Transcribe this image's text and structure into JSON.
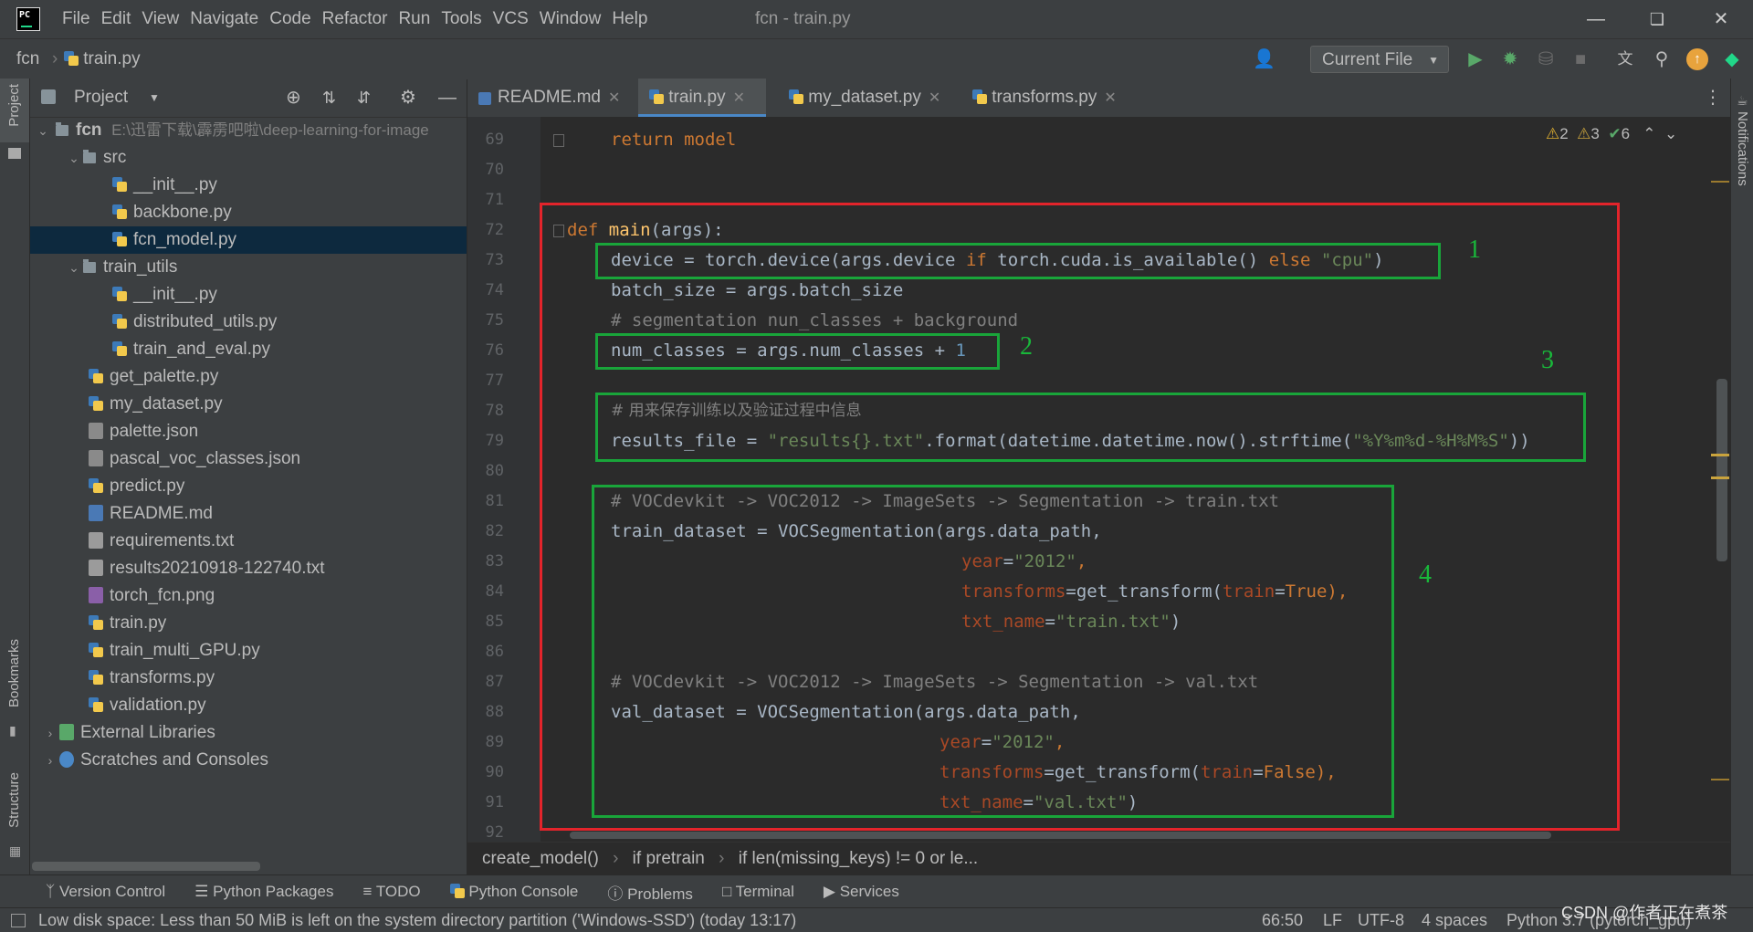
{
  "app": {
    "window_title": "fcn - train.py",
    "menu": [
      "File",
      "Edit",
      "View",
      "Navigate",
      "Code",
      "Refactor",
      "Run",
      "Tools",
      "VCS",
      "Window",
      "Help"
    ]
  },
  "navbar": {
    "project": "fcn",
    "file": "train.py",
    "run_config": "Current File"
  },
  "left_stripe": {
    "project": "Project",
    "bookmarks": "Bookmarks",
    "structure": "Structure"
  },
  "right_stripe": {
    "notifications": "Notifications"
  },
  "project_panel": {
    "title": "Project",
    "root_name": "fcn",
    "root_path": "E:\\迅雷下载\\霹雳吧啦\\deep-learning-for-image",
    "items": [
      {
        "name": "src",
        "type": "folder",
        "depth": 1,
        "expanded": true
      },
      {
        "name": "__init__.py",
        "type": "py",
        "depth": 2
      },
      {
        "name": "backbone.py",
        "type": "py",
        "depth": 2
      },
      {
        "name": "fcn_model.py",
        "type": "py",
        "depth": 2,
        "selected": true
      },
      {
        "name": "train_utils",
        "type": "folder",
        "depth": 1,
        "expanded": true
      },
      {
        "name": "__init__.py",
        "type": "py",
        "depth": 2
      },
      {
        "name": "distributed_utils.py",
        "type": "py",
        "depth": 2
      },
      {
        "name": "train_and_eval.py",
        "type": "py",
        "depth": 2
      },
      {
        "name": "get_palette.py",
        "type": "py",
        "depth": 1
      },
      {
        "name": "my_dataset.py",
        "type": "py",
        "depth": 1
      },
      {
        "name": "palette.json",
        "type": "json",
        "depth": 1
      },
      {
        "name": "pascal_voc_classes.json",
        "type": "json",
        "depth": 1
      },
      {
        "name": "predict.py",
        "type": "py",
        "depth": 1
      },
      {
        "name": "README.md",
        "type": "md",
        "depth": 1
      },
      {
        "name": "requirements.txt",
        "type": "txt",
        "depth": 1
      },
      {
        "name": "results20210918-122740.txt",
        "type": "txt",
        "depth": 1
      },
      {
        "name": "torch_fcn.png",
        "type": "png",
        "depth": 1
      },
      {
        "name": "train.py",
        "type": "py",
        "depth": 1
      },
      {
        "name": "train_multi_GPU.py",
        "type": "py",
        "depth": 1
      },
      {
        "name": "transforms.py",
        "type": "py",
        "depth": 1
      },
      {
        "name": "validation.py",
        "type": "py",
        "depth": 1
      },
      {
        "name": "External Libraries",
        "type": "lib",
        "depth": 0
      },
      {
        "name": "Scratches and Consoles",
        "type": "scratch",
        "depth": 0
      }
    ]
  },
  "tabs": [
    {
      "label": "README.md",
      "active": false
    },
    {
      "label": "train.py",
      "active": true
    },
    {
      "label": "my_dataset.py",
      "active": false
    },
    {
      "label": "transforms.py",
      "active": false
    }
  ],
  "inspections": {
    "warnings": "2",
    "weak_warnings": "3",
    "typos": "6"
  },
  "line_numbers": [
    "69",
    "70",
    "71",
    "72",
    "73",
    "74",
    "75",
    "76",
    "77",
    "78",
    "79",
    "80",
    "81",
    "82",
    "83",
    "84",
    "85",
    "86",
    "87",
    "88",
    "89",
    "90",
    "91",
    "92"
  ],
  "code": {
    "l69": "return model",
    "l72_def": "def ",
    "l72_fn": "main",
    "l72_rest": "(args):",
    "l73_a": "device = torch.device(args.device ",
    "l73_if": "if",
    "l73_b": " torch.cuda.is_available() ",
    "l73_else": "else",
    "l73_str": " \"cpu\"",
    "l73_end": ")",
    "l74": "batch_size = args.batch_size",
    "l75": "# segmentation nun_classes + background",
    "l76_a": "num_classes = args.num_classes + ",
    "l76_num": "1",
    "l78": "# 用来保存训练以及验证过程中信息",
    "l79_a": "results_file = ",
    "l79_str": "\"results{}.txt\"",
    "l79_b": ".format(datetime.datetime.now().strftime(",
    "l79_str2": "\"%Y%m%d-%H%M%S\"",
    "l79_end": "))",
    "l81": "# VOCdevkit -> VOC2012 -> ImageSets -> Segmentation -> train.txt",
    "l82": "train_dataset = VOCSegmentation(args.data_path,",
    "l83_p": "year",
    "l83_v": "=",
    "l83_s": "\"2012\"",
    "l83_c": ",",
    "l84_p": "transforms",
    "l84_a": "=get_transform(",
    "l84_p2": "train",
    "l84_b": "=",
    "l84_k": "True",
    "l84_c": "),",
    "l85_p": "txt_name",
    "l85_a": "=",
    "l85_s": "\"train.txt\"",
    "l85_c": ")",
    "l87": "# VOCdevkit -> VOC2012 -> ImageSets -> Segmentation -> val.txt",
    "l88": "val_dataset = VOCSegmentation(args.data_path,",
    "l89_p": "year",
    "l89_v": "=",
    "l89_s": "\"2012\"",
    "l89_c": ",",
    "l90_p": "transforms",
    "l90_a": "=get_transform(",
    "l90_p2": "train",
    "l90_b": "=",
    "l90_k": "False",
    "l90_c": "),",
    "l91_p": "txt_name",
    "l91_a": "=",
    "l91_s": "\"val.txt\"",
    "l91_c": ")"
  },
  "annotations": [
    "1",
    "2",
    "3",
    "4"
  ],
  "breadcrumb": [
    "create_model()",
    "if pretrain",
    "if len(missing_keys) != 0 or le..."
  ],
  "tool_windows": [
    "Version Control",
    "Python Packages",
    "TODO",
    "Python Console",
    "Problems",
    "Terminal",
    "Services"
  ],
  "status": {
    "message": "Low disk space: Less than 50 MiB is left on the system directory partition ('Windows-SSD') (today 13:17)",
    "position": "66:50",
    "line_sep": "LF",
    "encoding": "UTF-8",
    "indent": "4 spaces",
    "interpreter": "Python 3.7 (pytorch_gpu)"
  },
  "watermark": "CSDN @作者正在煮茶",
  "colors": {
    "red_box": "#e3242b",
    "green_box": "#19a53a",
    "selection": "#0d293e",
    "accent_tab": "#4a88c7"
  }
}
